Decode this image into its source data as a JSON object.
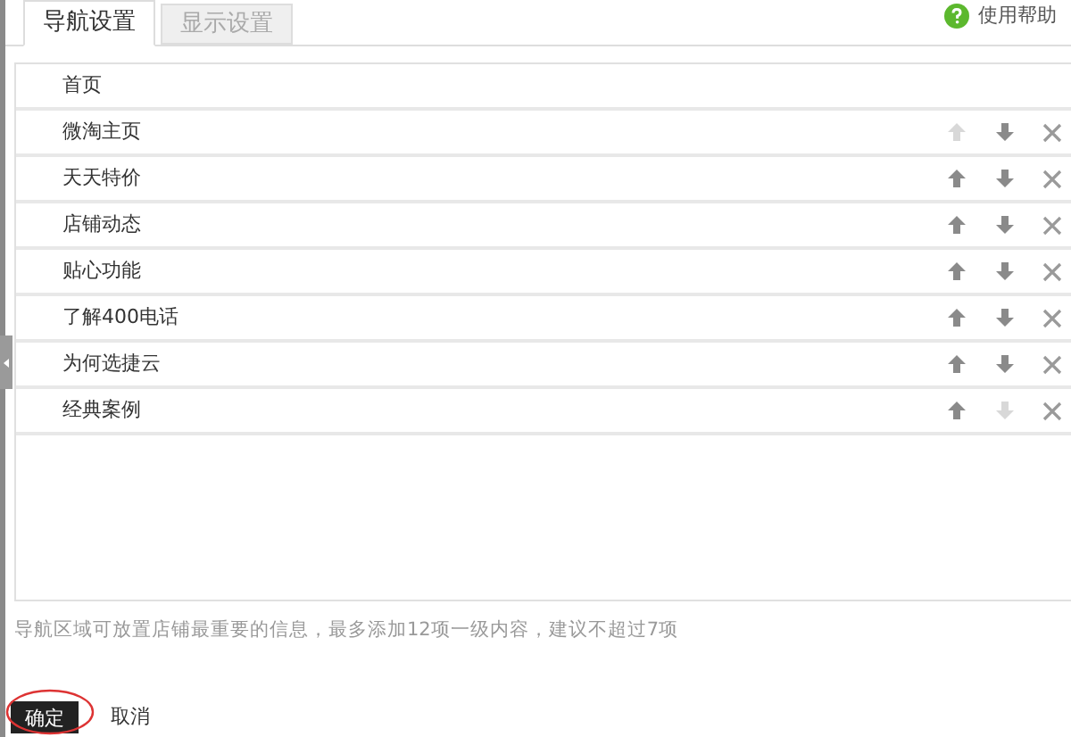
{
  "tabs": [
    {
      "label": "导航设置",
      "selected": true
    },
    {
      "label": "显示设置",
      "selected": false
    }
  ],
  "help_link": "使用帮助",
  "nav_items": [
    {
      "label": "首页",
      "fixed": true
    },
    {
      "label": "微淘主页",
      "fixed": false,
      "up_disabled": true,
      "down_disabled": false
    },
    {
      "label": "天天特价",
      "fixed": false,
      "up_disabled": false,
      "down_disabled": false
    },
    {
      "label": "店铺动态",
      "fixed": false,
      "up_disabled": false,
      "down_disabled": false
    },
    {
      "label": "贴心功能",
      "fixed": false,
      "up_disabled": false,
      "down_disabled": false
    },
    {
      "label": "了解400电话",
      "fixed": false,
      "up_disabled": false,
      "down_disabled": false
    },
    {
      "label": "为何选捷云",
      "fixed": false,
      "up_disabled": false,
      "down_disabled": false
    },
    {
      "label": "经典案例",
      "fixed": false,
      "up_disabled": false,
      "down_disabled": true
    }
  ],
  "hint": "导航区域可放置店铺最重要的信息，最多添加12项一级内容，建议不超过7项",
  "buttons": [
    {
      "label": "确定",
      "kind": "primary"
    },
    {
      "label": "取消",
      "kind": "link"
    }
  ]
}
